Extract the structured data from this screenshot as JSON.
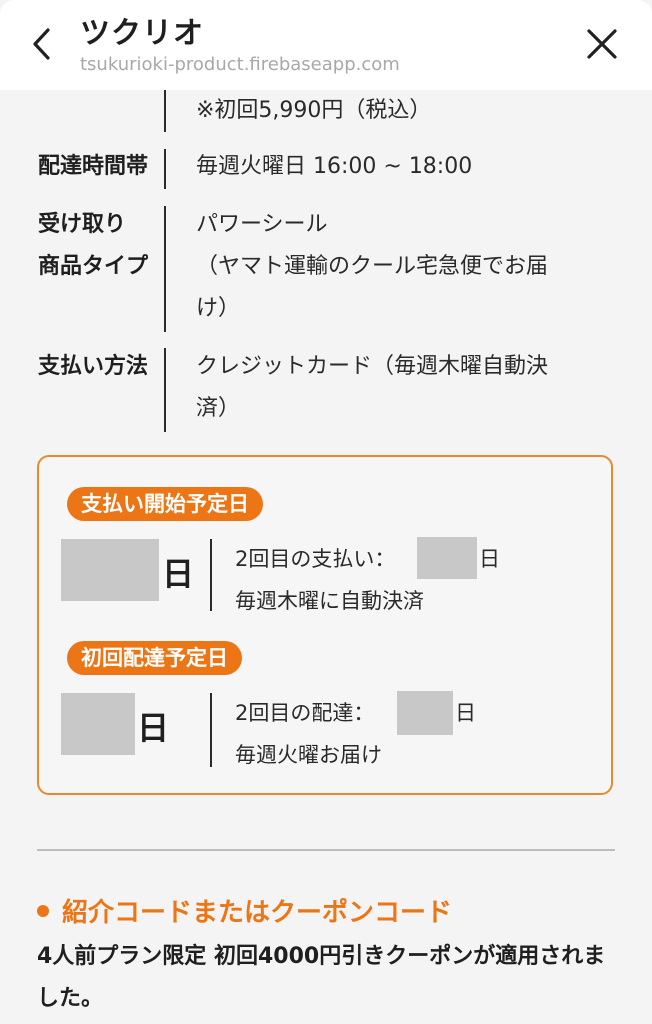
{
  "browser": {
    "title": "ツクリオ",
    "url": "tsukurioki-product.firebaseapp.com"
  },
  "details": {
    "price_note": "※初回5,990円（税込）",
    "delivery_slot_label": "配達時間帯",
    "delivery_slot_value": "毎週火曜日 16:00 ~ 18:00",
    "receive_label_line1": "受け取り",
    "receive_label_line2": "商品タイプ",
    "receive_value_line1": "パワーシール",
    "receive_value_line2": "（ヤマト運輸のクール宅急便でお届",
    "receive_value_line3": "け）",
    "payment_label": "支払い方法",
    "payment_value_line1": "クレジットカード（毎週木曜自動決",
    "payment_value_line2": "済）"
  },
  "schedule": {
    "payment": {
      "pill": "支払い開始予定日",
      "day_suffix": "日",
      "second_prefix": "2回目の支払い：",
      "second_suffix": "日",
      "note": "毎週木曜に自動決済"
    },
    "delivery": {
      "pill": "初回配達予定日",
      "day_suffix": "日",
      "second_prefix": "2回目の配達：",
      "second_suffix": "日",
      "note": "毎週火曜お届け"
    }
  },
  "coupon": {
    "title": "紹介コードまたはクーポンコード",
    "message": "4人前プラン限定 初回4000円引きクーポンが適用されました。"
  },
  "colors": {
    "accent": "#ec7516",
    "card_border": "#e8892c",
    "background": "#f4f4f4"
  },
  "icons": {
    "back": "chevron-left-icon",
    "close": "close-icon"
  }
}
